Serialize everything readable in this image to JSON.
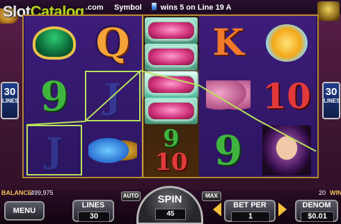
{
  "header": {
    "logo_main": "Slot",
    "logo_accent": "Catalog",
    "logo_suffix": ".com",
    "win_message_prefix": "Symbol",
    "win_message": "wins 5 on Line 19 A"
  },
  "reels": {
    "columns": [
      [
        "ring-symbol",
        "9",
        "J"
      ],
      [
        "Q",
        "J",
        "wings-symbol"
      ],
      [
        "heart-stack",
        "heart-stack",
        "9 10"
      ],
      [
        "K",
        "champagne-glasses-symbol",
        "9"
      ],
      [
        "diamond-crown-symbol",
        "10",
        "masquerade-mask-symbol"
      ]
    ],
    "col2_nine": "9",
    "col2_ten": "10"
  },
  "lines_badge": {
    "count": "30",
    "label": "LINES"
  },
  "footer": {
    "balance_label": "BALANCE",
    "balance_value": "499,975",
    "win_value": "20",
    "win_label": "WIN",
    "menu_label": "MENU",
    "auto_label": "AUTO",
    "max_label": "MAX",
    "lines_label": "LINES",
    "lines_value": "30",
    "spin_label": "SPIN",
    "spin_value": "45",
    "bet_per_label": "BET PER",
    "bet_per_value": "1",
    "denom_label": "DENOM",
    "denom_value": "$0.01"
  },
  "colors": {
    "accent_gold": "#f1c25b",
    "win_line": "#b9e25a",
    "reel_bg": "#2a1260"
  }
}
